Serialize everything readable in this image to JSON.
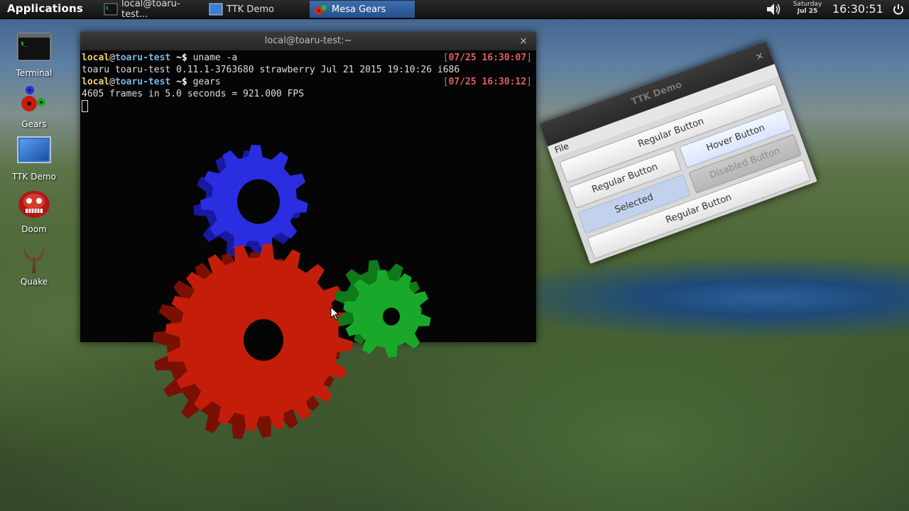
{
  "panel": {
    "applications_label": "Applications",
    "tasks": [
      {
        "label": "local@toaru-test...",
        "icon": "terminal-icon"
      },
      {
        "label": "TTK Demo",
        "icon": "window-icon"
      },
      {
        "label": "Mesa Gears",
        "icon": "gears-icon"
      }
    ],
    "date_day": "Saturday",
    "date_short": "Jul 25",
    "clock": "16:30:51"
  },
  "desktop_icons": [
    {
      "label": "Terminal",
      "icon": "terminal-icon"
    },
    {
      "label": "Gears",
      "icon": "gears-icon"
    },
    {
      "label": "TTK Demo",
      "icon": "window-icon"
    },
    {
      "label": "Doom",
      "icon": "doom-icon"
    },
    {
      "label": "Quake",
      "icon": "quake-icon"
    }
  ],
  "terminal": {
    "title": "local@toaru-test:~",
    "close": "×",
    "prompt_user": "local",
    "prompt_at": "@",
    "prompt_host": "toaru-test",
    "prompt_tail": " ~$ ",
    "cmd1": "uname -a",
    "ts1_date": "07/25",
    "ts1_time": "16:30:07",
    "out1": "toaru toaru-test 0.11.1-3763680 strawberry Jul 21 2015 19:10:26 i686",
    "cmd2": "gears",
    "ts2_date": "07/25",
    "ts2_time": "16:30:12",
    "out2": "4605 frames in 5.0 seconds = 921.000 FPS"
  },
  "ttk": {
    "title": "TTK Demo",
    "close": "×",
    "menu_file": "File",
    "buttons": {
      "regular_top": "Regular Button",
      "regular_left": "Regular Button",
      "hover": "Hover Button",
      "selected": "Selected",
      "disabled": "Disabled Button",
      "regular_bottom": "Regular Button"
    }
  },
  "colors": {
    "gear_red": "#c41e0a",
    "gear_green": "#1aa82a",
    "gear_blue": "#2a2ee0",
    "prompt_user": "#f0d070",
    "prompt_host": "#74b8e8",
    "timestamp": "#e05050"
  }
}
